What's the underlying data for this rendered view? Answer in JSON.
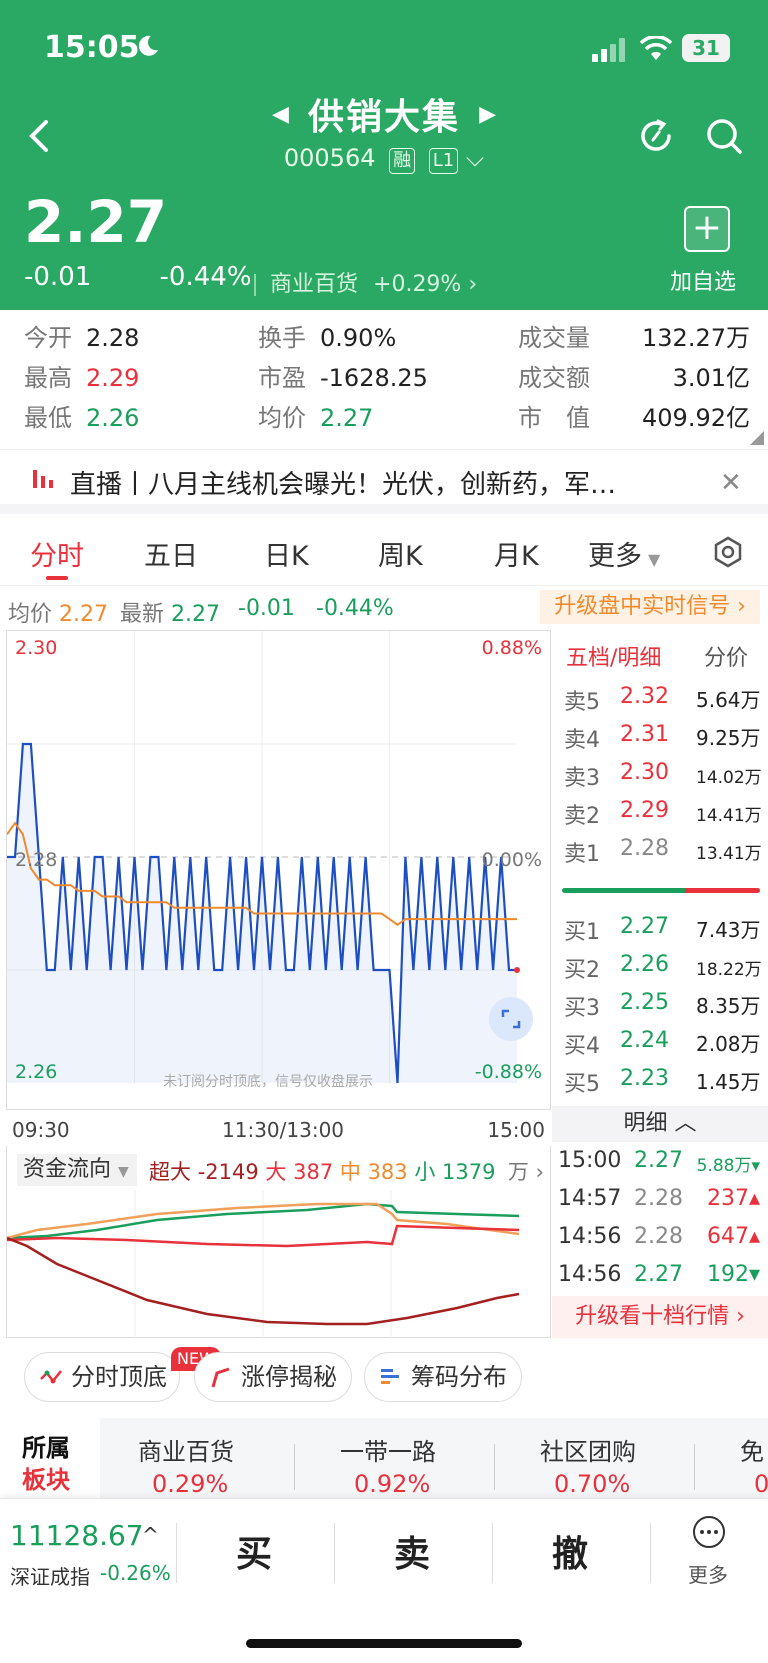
{
  "status": {
    "time": "15:05",
    "battery": "31"
  },
  "header": {
    "title": "供销大集",
    "code": "000564",
    "tag_rong": "融",
    "tag_level": "L1",
    "price": "2.27",
    "change": "-0.01",
    "change_pct": "-0.44%",
    "sector": "商业百货",
    "sector_pct": "+0.29%",
    "add_label": "加自选"
  },
  "stats": {
    "open_label": "今开",
    "open": "2.28",
    "high_label": "最高",
    "high": "2.29",
    "low_label": "最低",
    "low": "2.26",
    "turnover_label": "换手",
    "turnover": "0.90%",
    "pe_label": "市盈",
    "pe": "-1628.25",
    "avg_label": "均价",
    "avg": "2.27",
    "volume_label": "成交量",
    "volume": "132.27万",
    "amount_label": "成交额",
    "amount": "3.01亿",
    "mcap_label": "市　值",
    "mcap": "409.92亿"
  },
  "live": {
    "text": "直播丨八月主线机会曝光！光伏，创新药，军…"
  },
  "tabs": [
    "分时",
    "五日",
    "日K",
    "周K",
    "月K",
    "更多"
  ],
  "priceinfo": {
    "avg_label": "均价",
    "avg": "2.27",
    "latest_label": "最新",
    "latest": "2.27",
    "change": "-0.01",
    "change_pct": "-0.44%",
    "upgrade": "升级盘中实时信号"
  },
  "chart_data": {
    "type": "line",
    "y_top": "2.30",
    "y_mid": "2.28",
    "y_bottom": "2.26",
    "pct_top": "0.88%",
    "pct_mid": "0.00%",
    "pct_bottom": "-0.88%",
    "ylim": [
      2.26,
      2.3
    ],
    "x_ticks": [
      "09:30",
      "11:30/13:00",
      "15:00"
    ],
    "watermark": "未订阅分时顶底，信号仅收盘展示",
    "series": [
      {
        "values": [
          2.28,
          2.28,
          2.29,
          2.29,
          2.28,
          2.27,
          2.27,
          2.28,
          2.27,
          2.28,
          2.27,
          2.28,
          2.28,
          2.27,
          2.28,
          2.27,
          2.28,
          2.27,
          2.28,
          2.28,
          2.27,
          2.28,
          2.27,
          2.28,
          2.27,
          2.28,
          2.27,
          2.27,
          2.28,
          2.27,
          2.28,
          2.27,
          2.28,
          2.27,
          2.28,
          2.27,
          2.27,
          2.28,
          2.27,
          2.28,
          2.27,
          2.28,
          2.27,
          2.28,
          2.27,
          2.28,
          2.27,
          2.27,
          2.27,
          2.26,
          2.28,
          2.27,
          2.28,
          2.27,
          2.28,
          2.27,
          2.28,
          2.27,
          2.28,
          2.27,
          2.28,
          2.27,
          2.28,
          2.27,
          2.27
        ]
      },
      {
        "values": [
          2.282,
          2.283,
          2.282,
          2.279,
          2.278,
          2.278,
          2.2775,
          2.2775,
          2.2775,
          2.277,
          2.277,
          2.277,
          2.2765,
          2.2765,
          2.2765,
          2.276,
          2.276,
          2.276,
          2.276,
          2.276,
          2.276,
          2.2755,
          2.2755,
          2.2755,
          2.2755,
          2.2755,
          2.2755,
          2.2755,
          2.2755,
          2.2755,
          2.2755,
          2.275,
          2.275,
          2.275,
          2.275,
          2.275,
          2.275,
          2.275,
          2.275,
          2.275,
          2.275,
          2.275,
          2.275,
          2.275,
          2.275,
          2.275,
          2.275,
          2.275,
          2.2745,
          2.274,
          2.2745,
          2.2745,
          2.2745,
          2.2745,
          2.2745,
          2.2745,
          2.2745,
          2.2745,
          2.2745,
          2.2745,
          2.2745,
          2.2745,
          2.2745,
          2.2745,
          2.2745
        ]
      }
    ]
  },
  "orderbook": {
    "head": "五档/明细",
    "head2": "分价",
    "asks": [
      {
        "label": "卖5",
        "price": "2.32",
        "vol": "5.64万"
      },
      {
        "label": "卖4",
        "price": "2.31",
        "vol": "9.25万"
      },
      {
        "label": "卖3",
        "price": "2.30",
        "vol": "14.02万"
      },
      {
        "label": "卖2",
        "price": "2.29",
        "vol": "14.41万"
      },
      {
        "label": "卖1",
        "price": "2.28",
        "vol": "13.41万"
      }
    ],
    "bids": [
      {
        "label": "买1",
        "price": "2.27",
        "vol": "7.43万"
      },
      {
        "label": "买2",
        "price": "2.26",
        "vol": "18.22万"
      },
      {
        "label": "买3",
        "price": "2.25",
        "vol": "8.35万"
      },
      {
        "label": "买4",
        "price": "2.24",
        "vol": "2.08万"
      },
      {
        "label": "买5",
        "price": "2.23",
        "vol": "1.45万"
      }
    ]
  },
  "detail": {
    "head": "明细",
    "rows": [
      {
        "time": "15:00",
        "price": "2.27",
        "vol": "5.88万",
        "dir": "down"
      },
      {
        "time": "14:57",
        "price": "2.28",
        "vol": "237",
        "dir": "up"
      },
      {
        "time": "14:56",
        "price": "2.28",
        "vol": "647",
        "dir": "up"
      },
      {
        "time": "14:56",
        "price": "2.27",
        "vol": "192",
        "dir": "down"
      }
    ],
    "upgrade": "升级看十档行情"
  },
  "fundflow": {
    "head": "资金流向",
    "xl_label": "超大",
    "xl": "-2149",
    "l_label": "大",
    "l": "387",
    "m_label": "中",
    "m": "383",
    "s_label": "小",
    "s": "1379",
    "unit": "万"
  },
  "tools": [
    "分时顶底",
    "涨停揭秘",
    "筹码分布"
  ],
  "new_badge": "NEW",
  "sectors": {
    "label1": "所属",
    "label2": "板块",
    "items": [
      {
        "name": "商业百货",
        "pct": "0.29%"
      },
      {
        "name": "一带一路",
        "pct": "0.92%"
      },
      {
        "name": "社区团购",
        "pct": "0.70%"
      },
      {
        "name": "免",
        "pct": "0"
      }
    ]
  },
  "bottom": {
    "index_val": "11128.67",
    "index_name": "深证成指",
    "index_chg": "-0.26%",
    "buy": "买",
    "sell": "卖",
    "cancel": "撤",
    "more": "更多"
  },
  "colors": {
    "up": "#e8313b",
    "down": "#1a9e5c",
    "header": "#2aa964",
    "avg_line": "#f08a2c",
    "price_line": "#1d4fc2"
  }
}
